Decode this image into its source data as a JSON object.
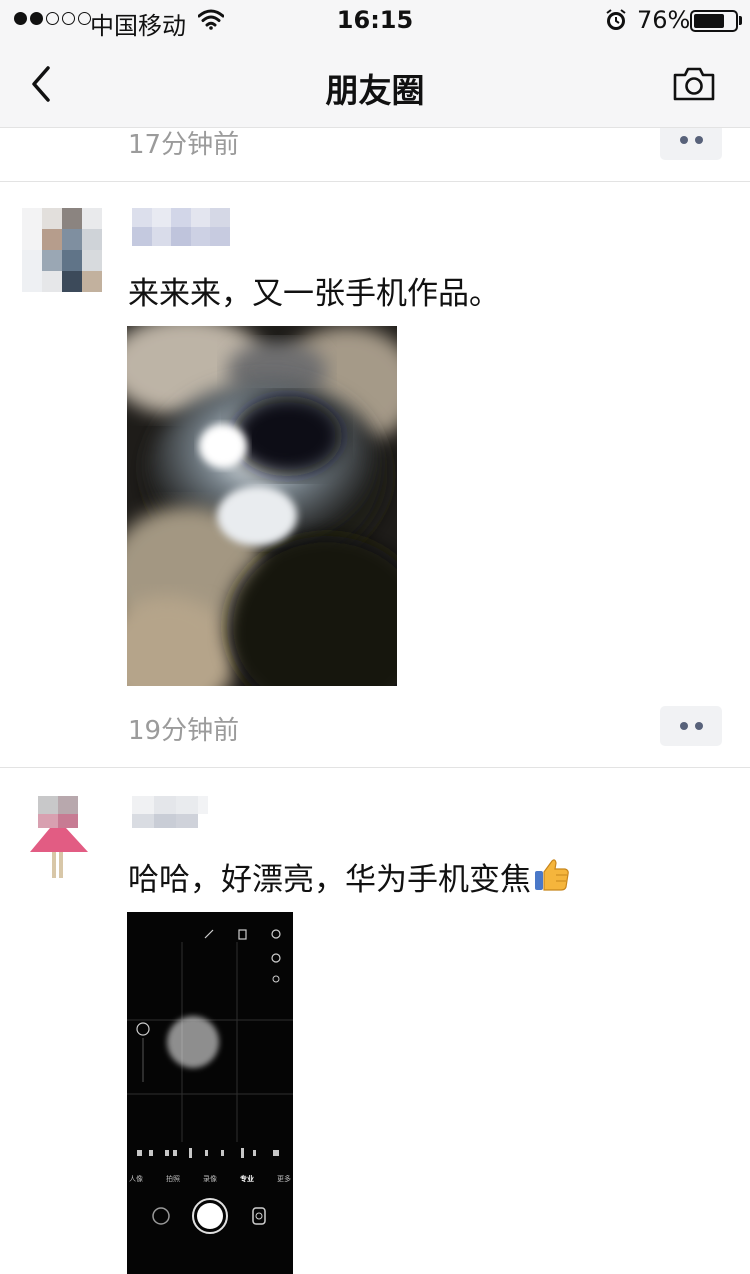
{
  "status_bar": {
    "carrier": "中国移动",
    "time": "16:15",
    "battery_percent_label": "76%",
    "battery_level": 0.76
  },
  "nav": {
    "title": "朋友圈"
  },
  "feed": {
    "previous_post": {
      "time": "17分钟前"
    },
    "posts": [
      {
        "text": "来来来，又一张手机作品。",
        "time": "19分钟前"
      },
      {
        "text": "哈哈，好漂亮，华为手机变焦"
      }
    ]
  },
  "camera_ui": {
    "modes": [
      "人像",
      "拍照",
      "录像",
      "专业",
      "更多"
    ]
  },
  "colors": {
    "time_text": "#9b9b9b",
    "more_button_bg": "#f1f2f4",
    "navbar_bg": "#f6f6f7"
  },
  "icons": [
    "wifi-icon",
    "alarm-icon",
    "battery-icon",
    "back-chevron-icon",
    "camera-icon",
    "more-dots-icon",
    "thumbs-up-emoji"
  ]
}
